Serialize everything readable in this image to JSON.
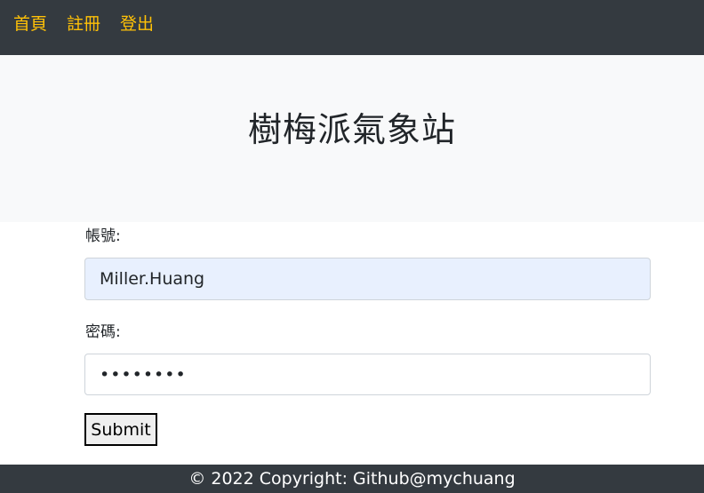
{
  "navbar": {
    "links": [
      {
        "label": "首頁"
      },
      {
        "label": "註冊"
      },
      {
        "label": "登出"
      }
    ]
  },
  "hero": {
    "title": "樹梅派氣象站"
  },
  "form": {
    "username_label": "帳號:",
    "username_value": "Miller.Huang",
    "password_label": "密碼:",
    "password_value": "••••••••",
    "submit_label": "Submit"
  },
  "footer": {
    "text": "© 2022 Copyright: Github@mychuang"
  },
  "colors": {
    "navbar_bg": "#343a40",
    "nav_link": "#ffc107",
    "hero_bg": "#f8f9fa",
    "autofill_bg": "#e8f0fe"
  }
}
